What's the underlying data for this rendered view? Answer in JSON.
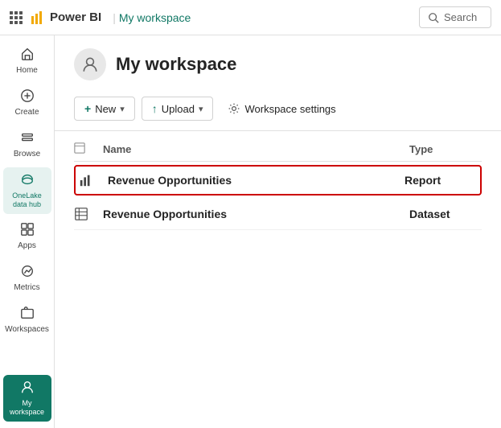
{
  "topbar": {
    "logo_icon": "⬛",
    "app_name": "Power BI",
    "workspace_link": "My workspace",
    "search_placeholder": "Search"
  },
  "sidebar": {
    "items": [
      {
        "id": "home",
        "label": "Home",
        "icon": "home"
      },
      {
        "id": "create",
        "label": "Create",
        "icon": "create"
      },
      {
        "id": "browse",
        "label": "Browse",
        "icon": "browse"
      },
      {
        "id": "onelake",
        "label": "OneLake data hub",
        "icon": "onelake"
      },
      {
        "id": "apps",
        "label": "Apps",
        "icon": "apps"
      },
      {
        "id": "metrics",
        "label": "Metrics",
        "icon": "metrics"
      },
      {
        "id": "workspaces",
        "label": "Workspaces",
        "icon": "workspaces"
      },
      {
        "id": "myworkspace",
        "label": "My workspace",
        "icon": "myworkspace",
        "active": true
      }
    ]
  },
  "page": {
    "title": "My workspace",
    "toolbar": {
      "new_label": "New",
      "upload_label": "Upload",
      "settings_label": "Workspace settings"
    },
    "table": {
      "col_name": "Name",
      "col_type": "Type",
      "rows": [
        {
          "name": "Revenue Opportunities",
          "type": "Report",
          "icon": "bar-chart",
          "highlighted": true
        },
        {
          "name": "Revenue Opportunities",
          "type": "Dataset",
          "icon": "dataset",
          "highlighted": false
        }
      ]
    }
  }
}
